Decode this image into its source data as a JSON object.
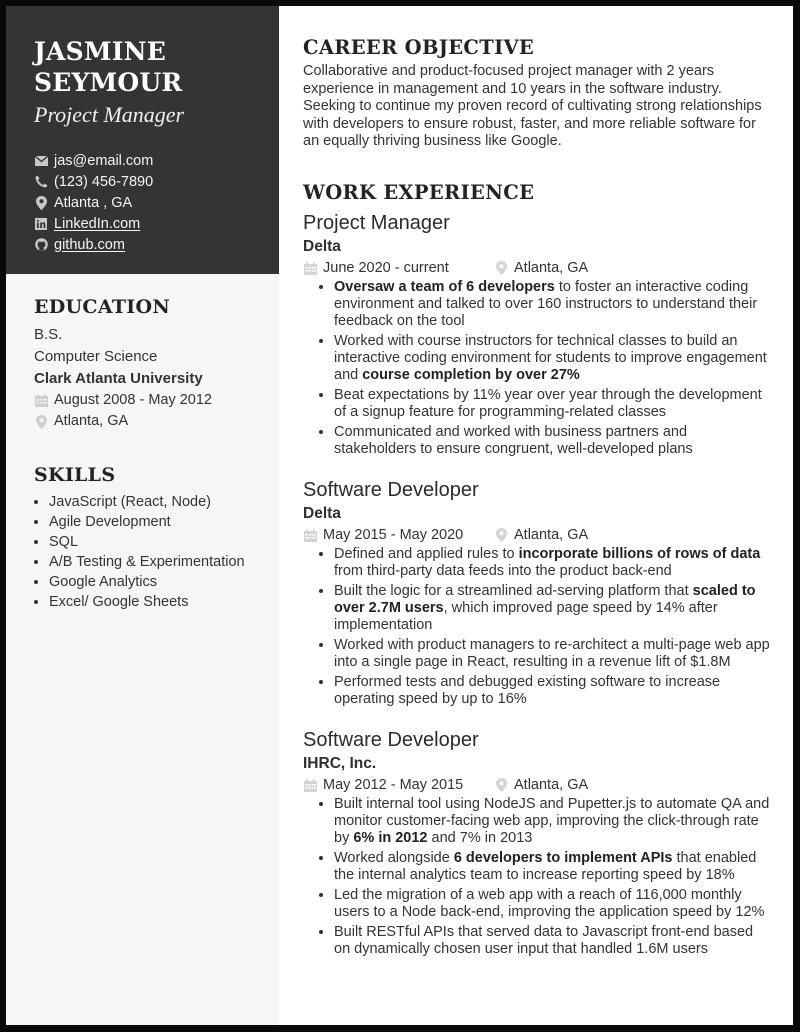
{
  "profile": {
    "first_name": "JASMINE",
    "last_name": "SEYMOUR",
    "role": "Project Manager",
    "contacts": [
      {
        "icon": "envelope-icon",
        "text": "jas@email.com",
        "link": false
      },
      {
        "icon": "phone-icon",
        "text": "(123) 456-7890",
        "link": false
      },
      {
        "icon": "location-pin-icon",
        "text": "Atlanta , GA",
        "link": false
      },
      {
        "icon": "linkedin-icon",
        "text": "LinkedIn.com",
        "link": true
      },
      {
        "icon": "github-icon",
        "text": "github.com",
        "link": true
      }
    ]
  },
  "education": {
    "title": "EDUCATION",
    "degree": "B.S.",
    "field": "Computer Science",
    "school": "Clark Atlanta University",
    "dates": "August 2008 - May 2012",
    "location": "Atlanta, GA"
  },
  "skills": {
    "title": "SKILLS",
    "items": [
      "JavaScript (React, Node)",
      "Agile Development",
      "SQL",
      "A/B Testing & Experimentation",
      "Google Analytics",
      "Excel/ Google Sheets"
    ]
  },
  "objective": {
    "title": "CAREER OBJECTIVE",
    "text": "Collaborative and product-focused project manager with 2 years experience in management and 10 years in the software industry. Seeking to continue my proven record of cultivating strong relationships with developers to ensure robust, faster, and more reliable software for an equally thriving business like Google."
  },
  "work": {
    "title": "WORK EXPERIENCE",
    "jobs": [
      {
        "title": "Project Manager",
        "company": "Delta",
        "dates": "June 2020 - current",
        "location": "Atlanta, GA",
        "bullets": [
          [
            {
              "b": "Oversaw a team of 6 developers"
            },
            {
              "t": " to foster an interactive coding environment and talked to over 160 instructors to understand their feedback on the tool"
            }
          ],
          [
            {
              "t": "Worked with course instructors for technical classes to build an interactive coding environment for students to improve engagement and "
            },
            {
              "b": "course completion by over 27%"
            }
          ],
          [
            {
              "t": "Beat expectations by 11% year over year through the development of a signup feature for programming-related classes"
            }
          ],
          [
            {
              "t": "Communicated and worked with business partners and stakeholders to ensure congruent, well-developed plans"
            }
          ]
        ]
      },
      {
        "title": "Software Developer",
        "company": "Delta",
        "dates": "May 2015 - May 2020",
        "location": "Atlanta, GA",
        "bullets": [
          [
            {
              "t": "Defined and applied rules to "
            },
            {
              "b": "incorporate billions of rows of data"
            },
            {
              "t": " from third-party data feeds into the product back-end"
            }
          ],
          [
            {
              "t": "Built the logic for a streamlined ad-serving platform that "
            },
            {
              "b": "scaled to over 2.7M users"
            },
            {
              "t": ", which improved page speed by 14% after implementation"
            }
          ],
          [
            {
              "t": "Worked with product managers to re-architect a multi-page web app into a single page in React, resulting in a revenue lift of $1.8M"
            }
          ],
          [
            {
              "t": "Performed tests and debugged existing software to increase operating speed by up to 16%"
            }
          ]
        ]
      },
      {
        "title": "Software Developer",
        "company": "IHRC, Inc.",
        "dates": "May 2012 - May 2015",
        "location": "Atlanta, GA",
        "bullets": [
          [
            {
              "t": "Built internal tool using NodeJS and Pupetter.js to automate QA and monitor customer-facing web app, improving the click-through rate by "
            },
            {
              "b": "6% in 2012"
            },
            {
              "t": " and 7% in 2013"
            }
          ],
          [
            {
              "t": "Worked alongside "
            },
            {
              "b": "6 developers to implement APIs"
            },
            {
              "t": " that enabled the internal analytics team to increase reporting speed by 18%"
            }
          ],
          [
            {
              "t": "Led the migration of a web app with a reach of 116,000 monthly users to a Node back-end, improving the application speed by 12%"
            }
          ],
          [
            {
              "t": "Built RESTful APIs that served data to Javascript front-end based on dynamically chosen user input that handled 1.6M users"
            }
          ]
        ]
      }
    ]
  },
  "colors": {
    "header_bg": "#343434",
    "sidebar_bg": "#f6f6f6",
    "frame": "#0a0a0a",
    "icon_gray": "#c4c4c4"
  }
}
